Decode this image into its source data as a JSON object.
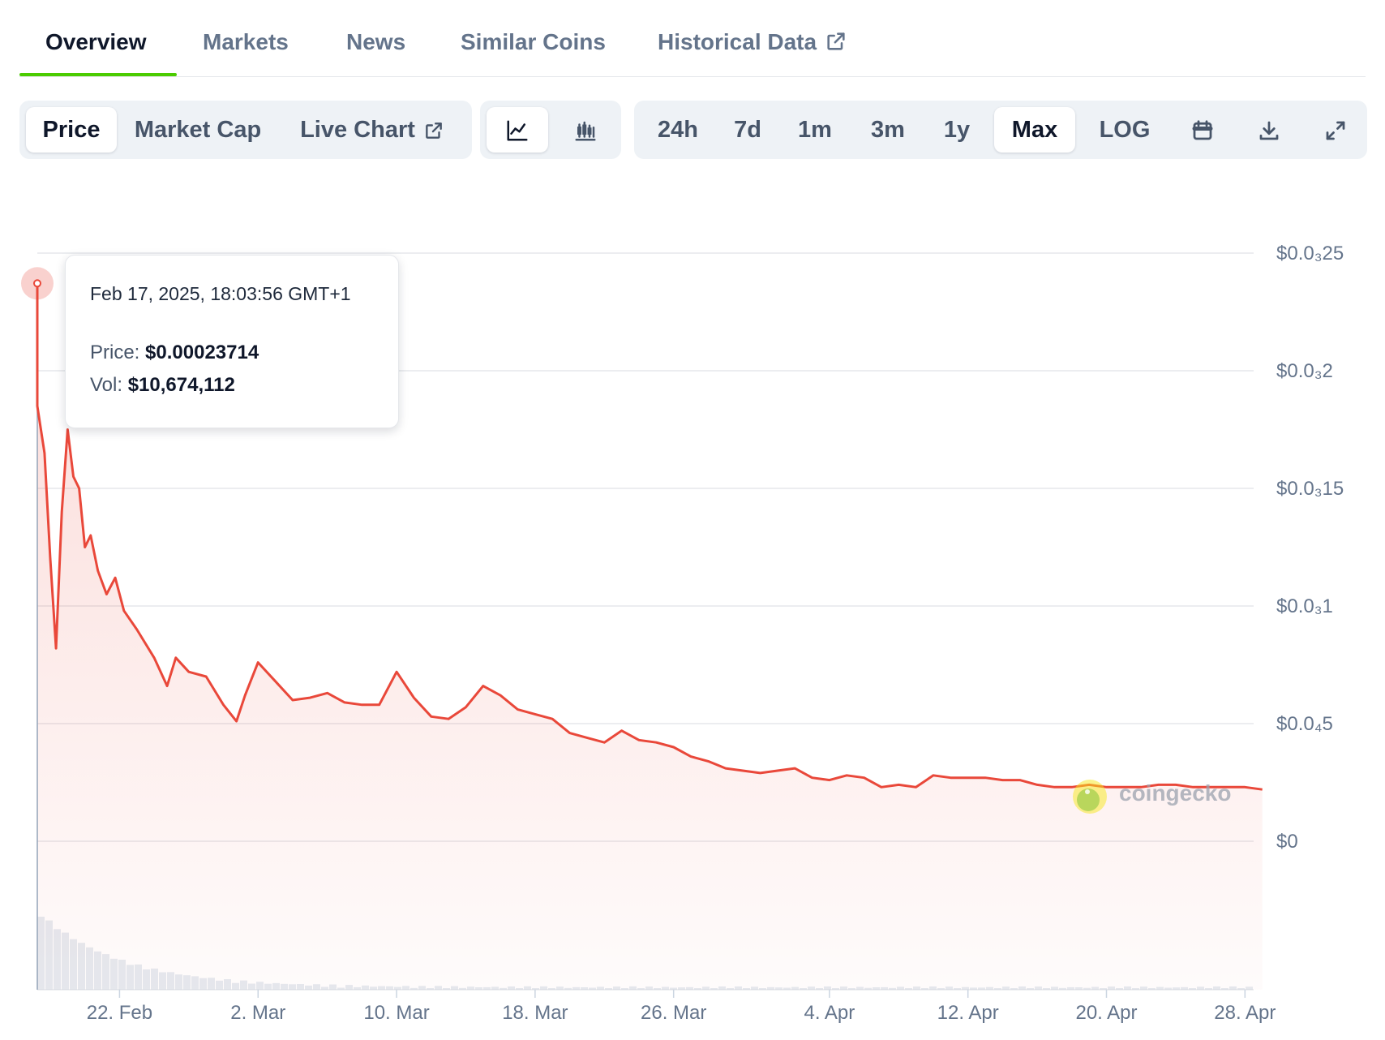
{
  "tabs": [
    {
      "label": "Overview",
      "active": true
    },
    {
      "label": "Markets",
      "active": false
    },
    {
      "label": "News",
      "active": false
    },
    {
      "label": "Similar Coins",
      "active": false
    },
    {
      "label": "Historical Data",
      "active": false,
      "external": true
    }
  ],
  "toolbar": {
    "chart_kind": [
      {
        "label": "Price",
        "active": true
      },
      {
        "label": "Market Cap",
        "active": false
      },
      {
        "label": "Live Chart",
        "active": false,
        "external": true
      }
    ],
    "chart_style": [
      {
        "icon": "line-chart-icon",
        "active": true
      },
      {
        "icon": "candlestick-icon",
        "active": false
      }
    ],
    "ranges": [
      {
        "label": "24h",
        "active": false
      },
      {
        "label": "7d",
        "active": false
      },
      {
        "label": "1m",
        "active": false
      },
      {
        "label": "3m",
        "active": false
      },
      {
        "label": "1y",
        "active": false
      },
      {
        "label": "Max",
        "active": true
      },
      {
        "label": "LOG",
        "active": false
      }
    ],
    "tools": [
      "calendar-icon",
      "download-icon",
      "fullscreen-icon"
    ]
  },
  "tooltip": {
    "date": "Feb 17, 2025, 18:03:56 GMT+1",
    "price_label": "Price:",
    "price_value": "$0.00023714",
    "vol_label": "Vol:",
    "vol_value": "$10,674,112"
  },
  "watermark": {
    "text": "coingecko"
  },
  "colors": {
    "line": "#e9483a",
    "accent": "#4bcc00",
    "grid": "#e5e7eb"
  },
  "chart_data": {
    "type": "area",
    "title": "",
    "xlabel": "",
    "ylabel": "",
    "grid": true,
    "x_start": "2025-02-17",
    "x_end": "2025-04-28",
    "x_ticks": [
      "22. Feb",
      "2. Mar",
      "10. Mar",
      "18. Mar",
      "26. Mar",
      "4. Apr",
      "12. Apr",
      "20. Apr",
      "28. Apr"
    ],
    "x_tick_dates": [
      "2025-02-22",
      "2025-03-02",
      "2025-03-10",
      "2025-03-18",
      "2025-03-26",
      "2025-04-04",
      "2025-04-12",
      "2025-04-20",
      "2025-04-28"
    ],
    "y_tick_labels": [
      "$0.0₃25",
      "$0.0₃2",
      "$0.0₃15",
      "$0.0₃1",
      "$0.0₄5",
      "$0"
    ],
    "y_tick_values": [
      0.00025,
      0.0002,
      0.00015,
      0.0001,
      5e-05,
      0
    ],
    "ylim": [
      0,
      0.00025
    ],
    "series": [
      {
        "points": [
          [
            "2025-02-17",
            0.000237
          ],
          [
            "2025-02-17",
            0.000185
          ],
          [
            "2025-02-18",
            0.000165
          ],
          [
            "2025-02-18",
            0.00012
          ],
          [
            "2025-02-18",
            8.2e-05
          ],
          [
            "2025-02-19",
            0.00014
          ],
          [
            "2025-02-19",
            0.000175
          ],
          [
            "2025-02-19",
            0.000155
          ],
          [
            "2025-02-20",
            0.00015
          ],
          [
            "2025-02-20",
            0.000125
          ],
          [
            "2025-02-20",
            0.00013
          ],
          [
            "2025-02-21",
            0.000115
          ],
          [
            "2025-02-21",
            0.000105
          ],
          [
            "2025-02-22",
            0.000112
          ],
          [
            "2025-02-22",
            9.8e-05
          ],
          [
            "2025-02-23",
            9e-05
          ],
          [
            "2025-02-24",
            7.8e-05
          ],
          [
            "2025-02-25",
            6.6e-05
          ],
          [
            "2025-02-25",
            7.8e-05
          ],
          [
            "2025-02-26",
            7.2e-05
          ],
          [
            "2025-02-27",
            7e-05
          ],
          [
            "2025-02-28",
            5.8e-05
          ],
          [
            "2025-03-01",
            5.1e-05
          ],
          [
            "2025-03-01",
            6.2e-05
          ],
          [
            "2025-03-02",
            7.6e-05
          ],
          [
            "2025-03-03",
            6.8e-05
          ],
          [
            "2025-03-04",
            6e-05
          ],
          [
            "2025-03-05",
            6.1e-05
          ],
          [
            "2025-03-06",
            6.3e-05
          ],
          [
            "2025-03-07",
            5.9e-05
          ],
          [
            "2025-03-08",
            5.8e-05
          ],
          [
            "2025-03-09",
            5.8e-05
          ],
          [
            "2025-03-10",
            7.2e-05
          ],
          [
            "2025-03-11",
            6.1e-05
          ],
          [
            "2025-03-12",
            5.3e-05
          ],
          [
            "2025-03-13",
            5.2e-05
          ],
          [
            "2025-03-14",
            5.7e-05
          ],
          [
            "2025-03-15",
            6.6e-05
          ],
          [
            "2025-03-16",
            6.2e-05
          ],
          [
            "2025-03-17",
            5.6e-05
          ],
          [
            "2025-03-18",
            5.4e-05
          ],
          [
            "2025-03-19",
            5.2e-05
          ],
          [
            "2025-03-20",
            4.6e-05
          ],
          [
            "2025-03-21",
            4.4e-05
          ],
          [
            "2025-03-22",
            4.2e-05
          ],
          [
            "2025-03-23",
            4.7e-05
          ],
          [
            "2025-03-24",
            4.3e-05
          ],
          [
            "2025-03-25",
            4.2e-05
          ],
          [
            "2025-03-26",
            4e-05
          ],
          [
            "2025-03-27",
            3.6e-05
          ],
          [
            "2025-03-28",
            3.4e-05
          ],
          [
            "2025-03-29",
            3.1e-05
          ],
          [
            "2025-03-30",
            3e-05
          ],
          [
            "2025-03-31",
            2.9e-05
          ],
          [
            "2025-04-01",
            3e-05
          ],
          [
            "2025-04-02",
            3.1e-05
          ],
          [
            "2025-04-03",
            2.7e-05
          ],
          [
            "2025-04-04",
            2.6e-05
          ],
          [
            "2025-04-05",
            2.8e-05
          ],
          [
            "2025-04-06",
            2.7e-05
          ],
          [
            "2025-04-07",
            2.3e-05
          ],
          [
            "2025-04-08",
            2.4e-05
          ],
          [
            "2025-04-09",
            2.3e-05
          ],
          [
            "2025-04-10",
            2.8e-05
          ],
          [
            "2025-04-11",
            2.7e-05
          ],
          [
            "2025-04-12",
            2.7e-05
          ],
          [
            "2025-04-13",
            2.7e-05
          ],
          [
            "2025-04-14",
            2.6e-05
          ],
          [
            "2025-04-15",
            2.6e-05
          ],
          [
            "2025-04-16",
            2.4e-05
          ],
          [
            "2025-04-17",
            2.3e-05
          ],
          [
            "2025-04-18",
            2.3e-05
          ],
          [
            "2025-04-19",
            2.4e-05
          ],
          [
            "2025-04-20",
            2.3e-05
          ],
          [
            "2025-04-21",
            2.3e-05
          ],
          [
            "2025-04-22",
            2.3e-05
          ],
          [
            "2025-04-23",
            2.4e-05
          ],
          [
            "2025-04-24",
            2.4e-05
          ],
          [
            "2025-04-25",
            2.3e-05
          ],
          [
            "2025-04-26",
            2.3e-05
          ],
          [
            "2025-04-27",
            2.3e-05
          ],
          [
            "2025-04-28",
            2.3e-05
          ],
          [
            "2025-04-29",
            2.2e-05
          ]
        ]
      }
    ],
    "highlight": {
      "date": "2025-02-17",
      "value": 0.00023714
    }
  }
}
